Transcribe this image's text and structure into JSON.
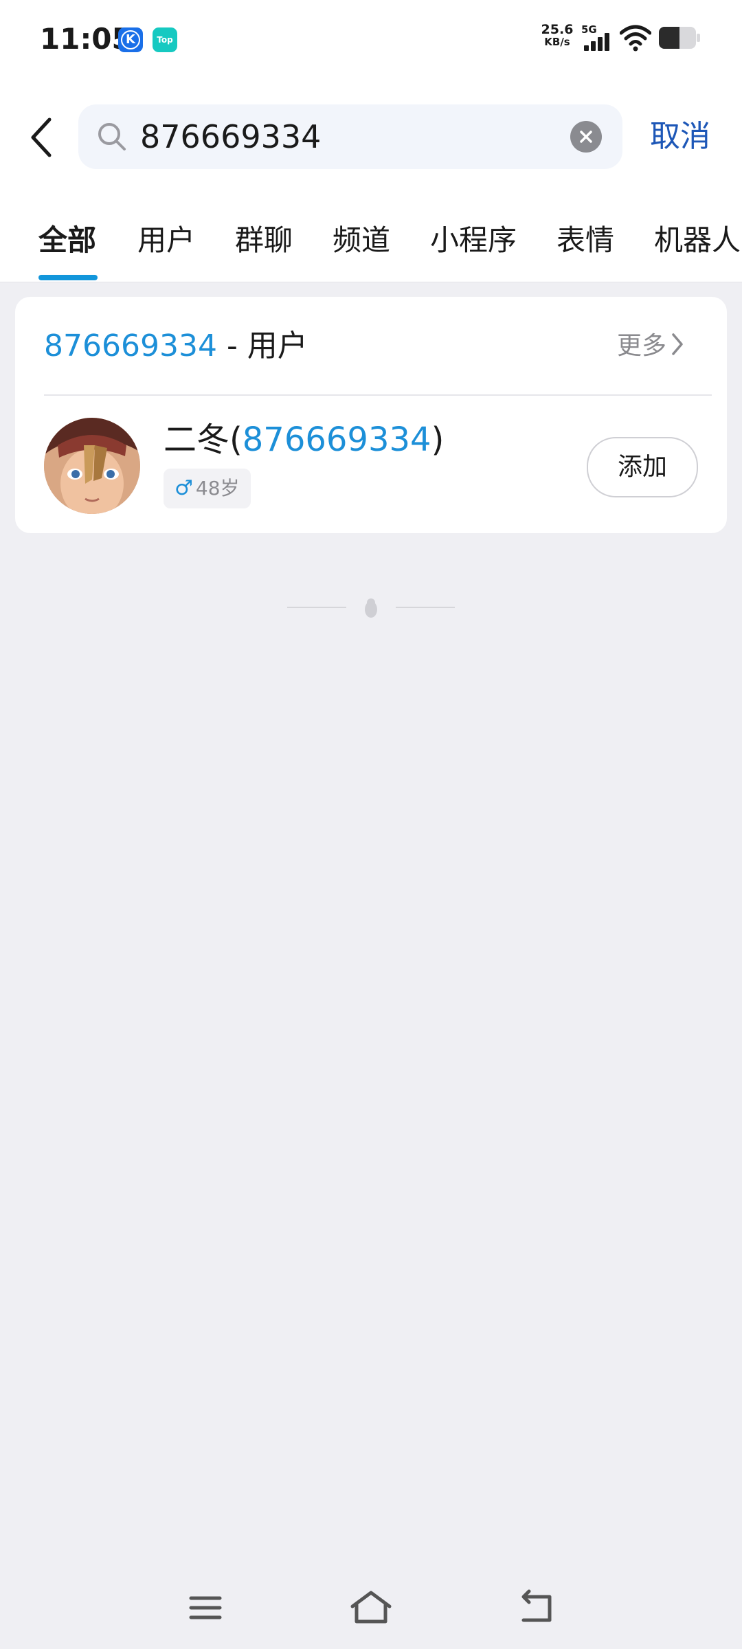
{
  "status_bar": {
    "time": "11:05",
    "net_speed_value": "25.6",
    "net_speed_unit": "KB/s",
    "network_type": "5G",
    "app_icon_k": "K",
    "app_icon_top": "Top",
    "icons": [
      "k-app-icon",
      "top-app-icon",
      "signal-icon",
      "wifi-icon",
      "battery-icon"
    ]
  },
  "search": {
    "query": "876669334",
    "cancel_label": "取消",
    "icons": [
      "back-icon",
      "search-icon",
      "clear-icon"
    ]
  },
  "tabs": [
    {
      "label": "全部",
      "active": true
    },
    {
      "label": "用户",
      "active": false
    },
    {
      "label": "群聊",
      "active": false
    },
    {
      "label": "频道",
      "active": false
    },
    {
      "label": "小程序",
      "active": false
    },
    {
      "label": "表情",
      "active": false
    },
    {
      "label": "机器人",
      "active": false
    }
  ],
  "result_section": {
    "query_number": "876669334",
    "title_suffix": " - 用户",
    "more_label": "更多"
  },
  "user": {
    "name": "二冬(",
    "qq_number": "876669334",
    "name_close": ")",
    "gender_symbol": "♂",
    "age": "48岁",
    "add_label": "添加"
  },
  "nav_bar": {
    "icons": [
      "menu-icon",
      "home-icon",
      "back-nav-icon"
    ]
  },
  "colors": {
    "accent": "#1296db",
    "number_blue": "#1c8fd8",
    "cancel_blue": "#1d57b7",
    "page_bg": "#efeff3"
  }
}
